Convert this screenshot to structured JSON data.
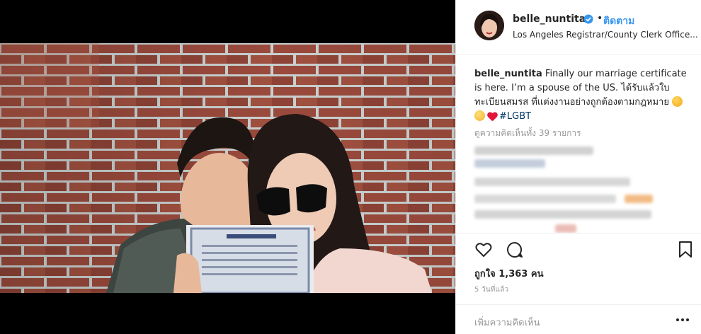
{
  "post": {
    "username": "belle_nuntita",
    "separator": "•",
    "follow_label": "ติดตาม",
    "location": "Los Angeles Registrar/County Clerk Office...",
    "caption_username": "belle_nuntita",
    "caption_text": "Finally our marriage certificate is here. I’m a spouse of the US. ได้รับแล้วใบทะเบียนสมรส ที่แต่งงานอย่างถูกต้องตามกฎหมาย",
    "caption_hashtag": "#LGBT",
    "view_all_comments": "ดูความคิดเห็นทั้ง 39 รายการ",
    "likes": "ถูกใจ 1,363 คน",
    "time_ago": "5 วันที่แล้ว",
    "add_comment_placeholder": "เพิ่มความคิดเห็น"
  },
  "icons": {
    "verified": "verified-badge-icon",
    "like": "heart-outline-icon",
    "comment": "comment-bubble-icon",
    "save": "bookmark-icon",
    "more": "more-options-icon"
  },
  "colors": {
    "accent": "#3897f0",
    "hashtag": "#003569",
    "muted": "#999999",
    "text": "#262626",
    "border": "#efefef"
  }
}
